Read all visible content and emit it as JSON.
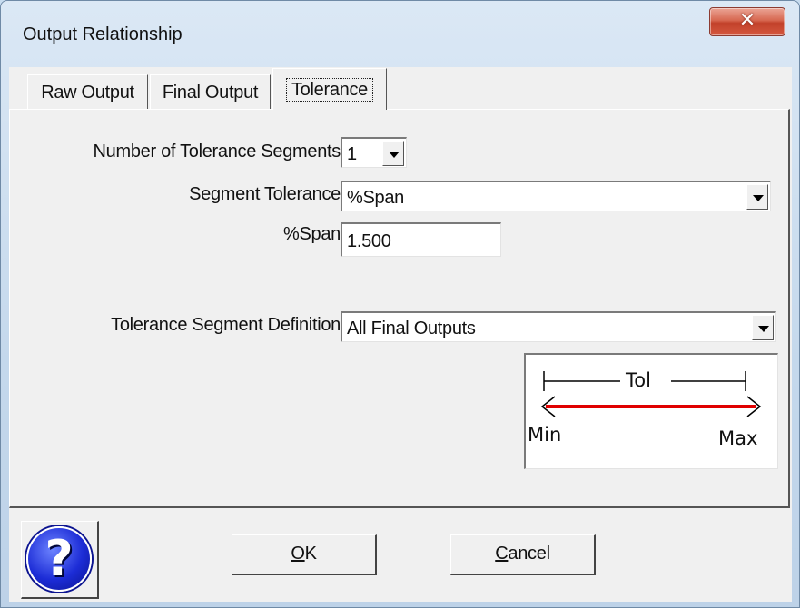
{
  "window": {
    "title": "Output Relationship",
    "close_glyph": "✕"
  },
  "tabs": [
    {
      "label": "Raw Output",
      "active": false
    },
    {
      "label": "Final Output",
      "active": false
    },
    {
      "label": "Tolerance",
      "active": true
    }
  ],
  "form": {
    "num_segments_label": "Number of Tolerance Segments",
    "num_segments_value": "1",
    "segment_tolerance_label": "Segment Tolerance",
    "segment_tolerance_value": "%Span",
    "span_label": "%Span",
    "span_value": "1.500",
    "segment_definition_label": "Tolerance Segment Definition",
    "segment_definition_value": "All Final Outputs"
  },
  "diagram": {
    "tol_label": "Tol",
    "min_label": "Min",
    "max_label": "Max",
    "arrow_color": "#e00000"
  },
  "buttons": {
    "help_glyph": "?",
    "ok_mnemonic": "O",
    "ok_rest": "K",
    "cancel_mnemonic": "C",
    "cancel_rest": "ancel"
  }
}
